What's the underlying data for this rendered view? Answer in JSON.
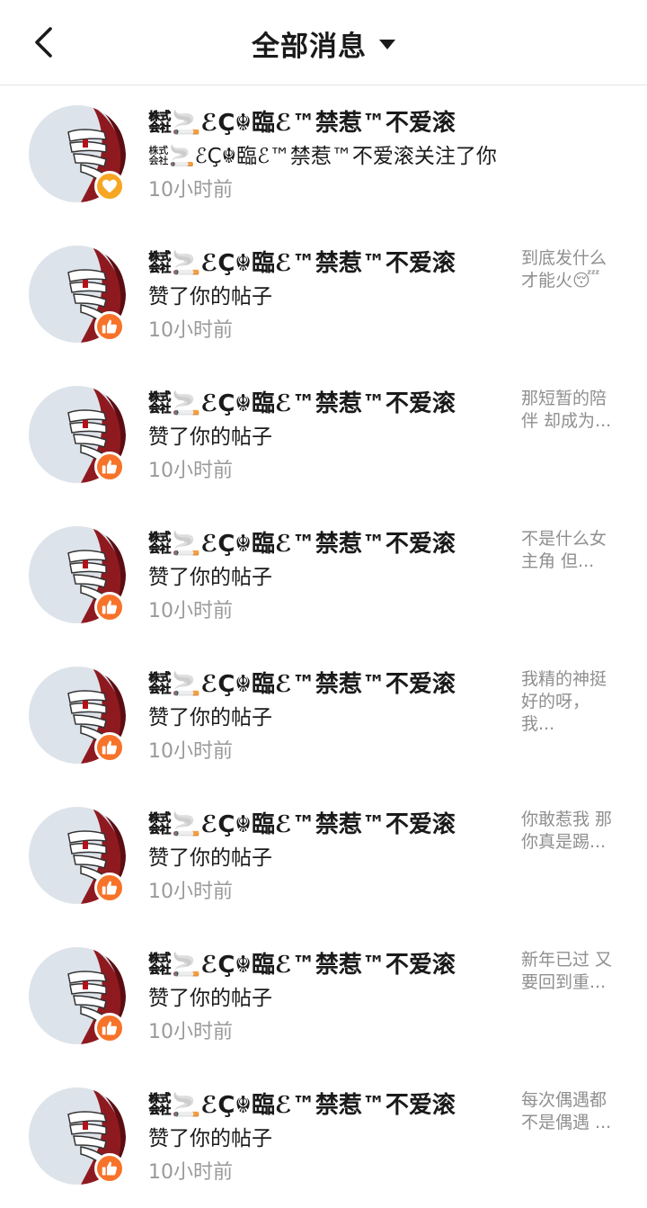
{
  "header": {
    "title": "全部消息"
  },
  "colors": {
    "like_badge": "#f7732a",
    "follow_badge": "#f7a623",
    "time_text": "#9a9a9a",
    "preview_text": "#8f8f8f"
  },
  "notifications": [
    {
      "username": "㍿🚬ℰÇ☬臨ℰ™禁惹™不爱滚",
      "action": "㍿🚬ℰÇ☬臨ℰ™禁惹™不爱滚关注了你",
      "time": "10小时前",
      "preview": "",
      "badge_icon": "heart-icon"
    },
    {
      "username": "㍿🚬ℰÇ☬臨ℰ™禁惹™不爱滚",
      "action": "赞了你的帖子",
      "time": "10小时前",
      "preview": "到底发什么才能火😴",
      "badge_icon": "thumbs-up-icon"
    },
    {
      "username": "㍿🚬ℰÇ☬臨ℰ™禁惹™不爱滚",
      "action": "赞了你的帖子",
      "time": "10小时前",
      "preview": "那短暂的陪伴 却成为...",
      "badge_icon": "thumbs-up-icon"
    },
    {
      "username": "㍿🚬ℰÇ☬臨ℰ™禁惹™不爱滚",
      "action": "赞了你的帖子",
      "time": "10小时前",
      "preview": "不是什么女主角 但...",
      "badge_icon": "thumbs-up-icon"
    },
    {
      "username": "㍿🚬ℰÇ☬臨ℰ™禁惹™不爱滚",
      "action": "赞了你的帖子",
      "time": "10小时前",
      "preview": "我精的神挺好的呀，我...",
      "badge_icon": "thumbs-up-icon"
    },
    {
      "username": "㍿🚬ℰÇ☬臨ℰ™禁惹™不爱滚",
      "action": "赞了你的帖子",
      "time": "10小时前",
      "preview": "你敢惹我 那你真是踢...",
      "badge_icon": "thumbs-up-icon"
    },
    {
      "username": "㍿🚬ℰÇ☬臨ℰ™禁惹™不爱滚",
      "action": "赞了你的帖子",
      "time": "10小时前",
      "preview": "新年已过 又要回到重...",
      "badge_icon": "thumbs-up-icon"
    },
    {
      "username": "㍿🚬ℰÇ☬臨ℰ™禁惹™不爱滚",
      "action": "赞了你的帖子",
      "time": "10小时前",
      "preview": "每次偶遇都不是偶遇 ...",
      "badge_icon": "thumbs-up-icon"
    }
  ]
}
